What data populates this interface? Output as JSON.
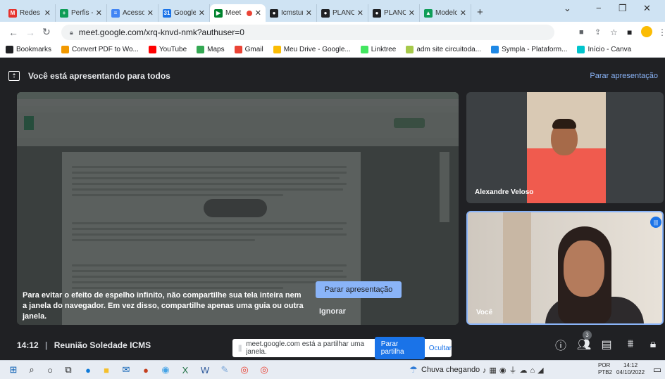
{
  "browser": {
    "tabs": [
      {
        "title": "Redes Soc",
        "fav_color": "#e5322d",
        "fav_glyph": "M"
      },
      {
        "title": "Perfis - Pa",
        "fav_color": "#0f9d58",
        "fav_glyph": "+"
      },
      {
        "title": "Acessos d",
        "fav_color": "#4285f4",
        "fav_glyph": "≡"
      },
      {
        "title": "Google Ag",
        "fav_color": "#1a73e8",
        "fav_glyph": "31"
      },
      {
        "title": "Meet",
        "fav_color": "#00832d",
        "fav_glyph": "▶",
        "active": true
      },
      {
        "title": "Icmsturism",
        "fav_color": "#202124",
        "fav_glyph": "●"
      },
      {
        "title": "PLANO DE",
        "fav_color": "#202124",
        "fav_glyph": "●"
      },
      {
        "title": "PLANO DE",
        "fav_color": "#202124",
        "fav_glyph": "●"
      },
      {
        "title": "Modelos",
        "fav_color": "#0f9d58",
        "fav_glyph": "▲"
      }
    ],
    "new_tab": "+",
    "url": "meet.google.com/xrq-knvd-nmk?authuser=0",
    "bookmarks": [
      {
        "label": "Bookmarks",
        "color": "#202124"
      },
      {
        "label": "Convert PDF to Wo...",
        "color": "#f29900"
      },
      {
        "label": "YouTube",
        "color": "#ff0000"
      },
      {
        "label": "Maps",
        "color": "#34a853"
      },
      {
        "label": "Gmail",
        "color": "#ea4335"
      },
      {
        "label": "Meu Drive - Google...",
        "color": "#fbbc04"
      },
      {
        "label": "Linktree",
        "color": "#43e660"
      },
      {
        "label": "adm site circuitoda...",
        "color": "#a6c94a"
      },
      {
        "label": "Sympla - Plataform...",
        "color": "#1e88e5"
      },
      {
        "label": "Início - Canva",
        "color": "#00c4cc"
      }
    ]
  },
  "meet": {
    "presenting_text": "Você está apresentando para todos",
    "stop_presenting_link": "Parar apresentação",
    "warning_text": "Para evitar o efeito de espelho infinito, não compartilhe sua tela inteira nem a janela do navegador. Em vez disso, compartilhe apenas uma guia ou outra janela.",
    "stop_button": "Parar apresentação",
    "ignore_button": "Ignorar",
    "participants": [
      {
        "name": "Alexandre Veloso"
      },
      {
        "name": "Você"
      }
    ],
    "time": "14:12",
    "meeting_title": "Reunião Soledade ICMS",
    "participant_count": "3",
    "notice": {
      "text": "meet.google.com está a partilhar uma janela.",
      "stop": "Parar partilha",
      "hide": "Ocultar"
    }
  },
  "taskbar": {
    "weather": "Chuva chegando",
    "lang": "POR",
    "lang2": "PTB2",
    "time": "14:12",
    "date": "04/10/2022"
  }
}
